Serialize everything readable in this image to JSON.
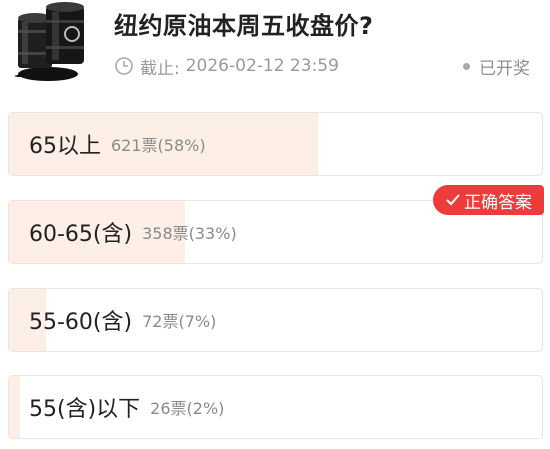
{
  "question": {
    "title": "纽约原油本周五收盘价?",
    "deadline_label": "截止:",
    "deadline": "2026-02-12 23:59",
    "status": "已开奖"
  },
  "correct_badge": "正确答案",
  "options": [
    {
      "label": "65以上",
      "count": "621票(58%)",
      "percent": 58
    },
    {
      "label": "60-65(含)",
      "count": "358票(33%)",
      "percent": 33
    },
    {
      "label": "55-60(含)",
      "count": "72票(7%)",
      "percent": 7
    },
    {
      "label": "55(含)以下",
      "count": "26票(2%)",
      "percent": 2
    }
  ],
  "icons": {
    "thumbnail": "oil-barrel-icon",
    "deadline": "clock-icon",
    "correct": "check-icon",
    "status": "dot-icon"
  },
  "colors": {
    "fill": "#fdeee6",
    "badge": "#ee3b3b"
  }
}
